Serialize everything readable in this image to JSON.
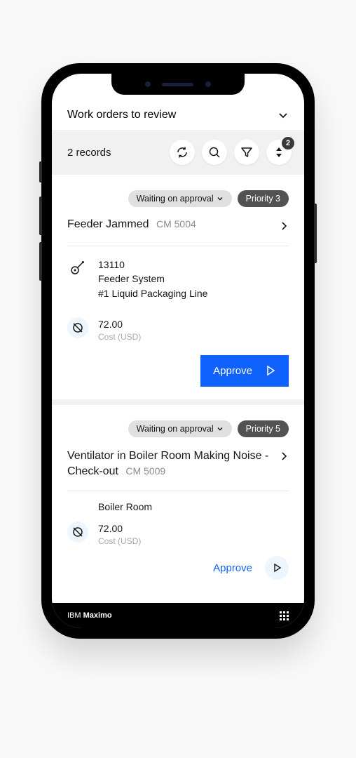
{
  "header": {
    "title": "Work orders to review"
  },
  "toolbar": {
    "records_label": "2 records",
    "sort_badge": "2"
  },
  "records": [
    {
      "status": "Waiting on approval",
      "priority": "Priority 3",
      "title": "Feeder Jammed",
      "code": "CM 5004",
      "asset_id": "13110",
      "asset_name": "Feeder System",
      "asset_line": "#1 Liquid Packaging Line",
      "cost_value": "72.00",
      "cost_label": "Cost (USD)",
      "action": "Approve"
    },
    {
      "status": "Waiting on approval",
      "priority": "Priority 5",
      "title": "Ventilator in Boiler Room Making Noise - Check-out",
      "code": "CM 5009",
      "location": "Boiler Room",
      "cost_value": "72.00",
      "cost_label": "Cost (USD)",
      "action": "Approve"
    }
  ],
  "footer": {
    "brand_prefix": "IBM ",
    "brand_name": "Maximo"
  }
}
